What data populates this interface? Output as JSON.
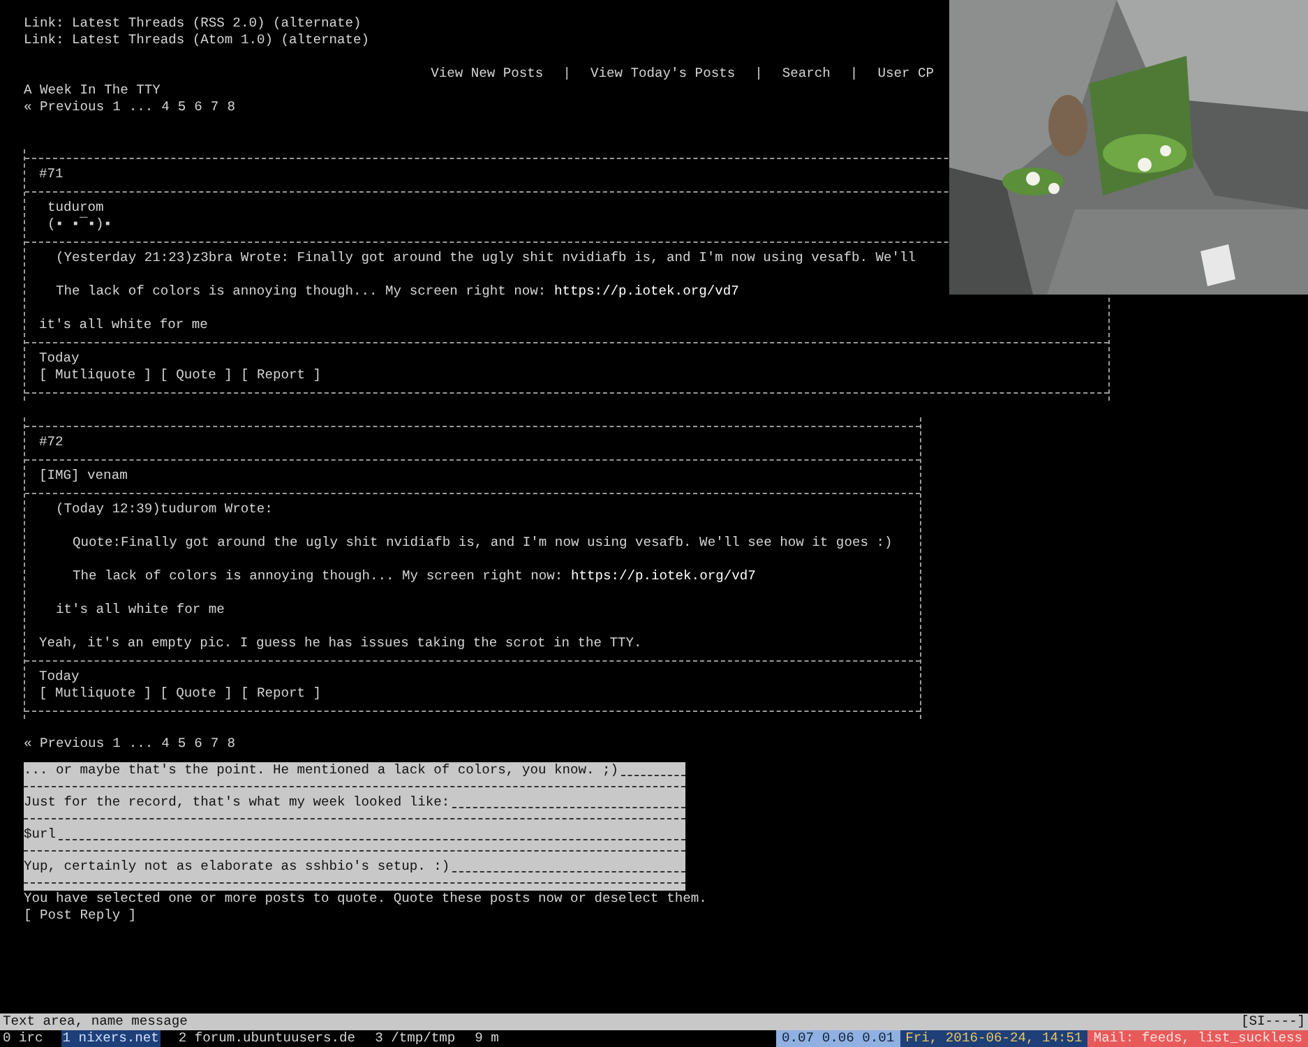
{
  "header": {
    "links": [
      "Link: Latest Threads (RSS 2.0) (alternate)",
      "Link: Latest Threads (Atom 1.0) (alternate)"
    ],
    "nav": {
      "links": [
        "View New Posts",
        "View Today's Posts",
        "Search",
        "User CP"
      ],
      "separators": [
        "|",
        "|",
        "|"
      ]
    },
    "thread_title": "A Week In The TTY"
  },
  "pagination_top": {
    "prev": "« Previous",
    "first": "1",
    "gap": "...",
    "pages": [
      "4",
      "5",
      "6",
      "7",
      "8"
    ]
  },
  "posts": [
    {
      "number": "#71",
      "wide": true,
      "author_lines": [
        "tudurom",
        "(▪ ▪¯▪)▪"
      ],
      "body": [
        {
          "kind": "quote_header",
          "text": "(Yesterday 21:23)z3bra Wrote:  Finally got around the ugly shit nvidiafb is, and I'm now using vesafb. We'll"
        },
        {
          "kind": "quoted",
          "text": "The lack of colors is annoying though... My screen right now: ",
          "link": "https://p.iotek.org/vd7"
        },
        {
          "kind": "reply",
          "text": "it's all white for me"
        }
      ],
      "date": "Today",
      "actions": [
        "[ Mutliquote ]",
        "[ Quote ]",
        "[ Report ]"
      ]
    },
    {
      "number": "#72",
      "wide": false,
      "author_lines": [
        "[IMG] venam"
      ],
      "body": [
        {
          "kind": "quote_header",
          "text": "(Today 12:39)tudurom Wrote:"
        },
        {
          "kind": "nested_quoted",
          "text": "Quote:Finally got around the ugly shit nvidiafb is, and I'm now using vesafb. We'll see how it goes :)"
        },
        {
          "kind": "nested_quoted",
          "text": "The lack of colors is annoying though... My screen right now: ",
          "link": "https://p.iotek.org/vd7"
        },
        {
          "kind": "quoted",
          "text": "it's all white for me"
        },
        {
          "kind": "reply",
          "text": "Yeah, it's an empty pic. I guess he has issues taking the scrot in the TTY."
        }
      ],
      "date": "Today",
      "actions": [
        "[ Mutliquote ]",
        "[ Quote ]",
        "[ Report ]"
      ]
    }
  ],
  "pagination_bottom": {
    "prev": "« Previous",
    "first": "1",
    "gap": "...",
    "pages": [
      "4",
      "5",
      "6",
      "7",
      "8"
    ]
  },
  "reply_box": {
    "lines": [
      "... or maybe that's the point. He mentioned a lack of colors, you know. ;)",
      "Just for the record, that's what my week looked like:",
      "$url",
      "Yup, certainly not as elaborate as sshbio's setup. :)"
    ]
  },
  "quote_notice": "You have selected one or more posts to quote. Quote these posts now or deselect them.",
  "post_reply_button": "[ Post Reply ]",
  "status_bar": {
    "message": "Text area, name message",
    "mode": "[SI----]",
    "windows": [
      {
        "label": "0 irc",
        "selected": false
      },
      {
        "label": "1 nixers.net",
        "selected": true
      },
      {
        "label": "2 forum.ubuntuusers.de",
        "selected": false
      },
      {
        "label": "3 /tmp/tmp",
        "selected": false
      },
      {
        "label": "9 m",
        "selected": false
      }
    ],
    "segments": [
      {
        "text": "0.07 0.06 0.01",
        "color": "#8fb0e0"
      },
      {
        "text": "Fri, 2016-06-24, 14:51",
        "color": "#1e3f78"
      },
      {
        "text": "Mail: feeds, list_suckless",
        "color": "#e85a5a"
      }
    ]
  }
}
